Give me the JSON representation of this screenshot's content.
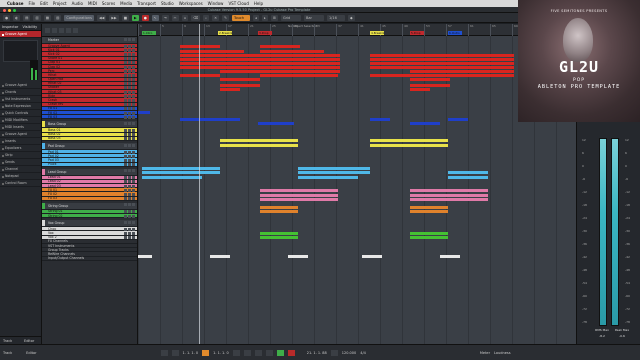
{
  "menubar": {
    "items": [
      "Cubase",
      "File",
      "Edit",
      "Project",
      "Audio",
      "MIDI",
      "Scores",
      "Media",
      "Transport",
      "Studio",
      "Workspaces",
      "Window",
      "VST Cloud",
      "Help"
    ],
    "clock": ""
  },
  "titlebar": {
    "text": "Cubase Version 9.5.50 Project - GL2u Cubase Pro Template"
  },
  "toolbar": {
    "configurations": "Configurations",
    "touch_mode": "Touch",
    "grid_mode": "Grid",
    "grid_type": "Bar",
    "quantize": "1/16"
  },
  "inspector": {
    "tabs": [
      "Inspector",
      "Visibility"
    ],
    "track_name": "Groove Agent",
    "rows": [
      "Groove Agent",
      "Chords",
      "Vst Instruments",
      "Note Expression",
      "Quick Controls",
      "MIDI Modifiers",
      "MIDI Inserts",
      "Groove Agent",
      "Inserts",
      "Equalizers",
      "Strip",
      "Sends",
      "Channel",
      "Notepad",
      "Control Room"
    ],
    "bottom_tabs": [
      "Track",
      "Editor"
    ]
  },
  "tracks": [
    {
      "name": "Marker",
      "color": "#3b3f45",
      "type": "folder"
    },
    {
      "name": "Groove Agent",
      "color": "#c0292e"
    },
    {
      "name": "Kick 01",
      "color": "#c0292e"
    },
    {
      "name": "Kick 02",
      "color": "#c0292e"
    },
    {
      "name": "Snare 01",
      "color": "#c0292e"
    },
    {
      "name": "Clap 01",
      "color": "#c0292e"
    },
    {
      "name": "Clap 02",
      "color": "#c0292e"
    },
    {
      "name": "Perc",
      "color": "#c0292e"
    },
    {
      "name": "Hihat",
      "color": "#c0292e"
    },
    {
      "name": "Open Hat",
      "color": "#c0292e"
    },
    {
      "name": "Hihat 02",
      "color": "#c0292e"
    },
    {
      "name": "Shaker",
      "color": "#c0292e"
    },
    {
      "name": "Hihat 03",
      "color": "#c0292e"
    },
    {
      "name": "Ride",
      "color": "#c0292e"
    },
    {
      "name": "Crash",
      "color": "#c0292e"
    },
    {
      "name": "Crash rev",
      "color": "#c0292e"
    },
    {
      "name": "Fill 01",
      "color": "#1f4fd1"
    },
    {
      "name": "Fill 02",
      "color": "#1f4fd1"
    },
    {
      "name": "Fill 03",
      "color": "#1f4fd1"
    },
    {
      "name": "Bass Group",
      "color": "#e8e04a",
      "type": "folder"
    },
    {
      "name": "Bass 01",
      "color": "#e8e04a"
    },
    {
      "name": "Bass 02",
      "color": "#e8e04a"
    },
    {
      "name": "Bass 03",
      "color": "#e8e04a"
    },
    {
      "name": "Pad Group",
      "color": "#4fb3e8",
      "type": "folder"
    },
    {
      "name": "Pad 01",
      "color": "#4fb3e8"
    },
    {
      "name": "Pad 02",
      "color": "#4fb3e8"
    },
    {
      "name": "Pad 03",
      "color": "#4fb3e8"
    },
    {
      "name": "Pluck",
      "color": "#4fb3e8"
    },
    {
      "name": "Lead Group",
      "color": "#e07aa8",
      "type": "folder"
    },
    {
      "name": "Lead 01",
      "color": "#e07aa8"
    },
    {
      "name": "Lead 02",
      "color": "#e07aa8"
    },
    {
      "name": "Lead 03",
      "color": "#e07aa8"
    },
    {
      "name": "FX 01",
      "color": "#e0822c"
    },
    {
      "name": "FX 02",
      "color": "#e0822c"
    },
    {
      "name": "FX 03",
      "color": "#e0822c"
    },
    {
      "name": "String Group",
      "color": "#3fae49",
      "type": "folder"
    },
    {
      "name": "String 01",
      "color": "#3fae49"
    },
    {
      "name": "String 02",
      "color": "#3fae49"
    },
    {
      "name": "Vox Group",
      "color": "#d9d9d9",
      "type": "folder"
    },
    {
      "name": "Chop",
      "color": "#d9d9d9"
    },
    {
      "name": "Vox",
      "color": "#d9d9d9"
    },
    {
      "name": "Vox 2",
      "color": "#d9d9d9"
    },
    {
      "name": "FX Channels",
      "color": "#2a2d32",
      "type": "sub"
    },
    {
      "name": "VST Instruments",
      "color": "#2a2d32",
      "type": "sub"
    },
    {
      "name": "Group Tracks",
      "color": "#2a2d32",
      "type": "sub"
    },
    {
      "name": "ReWire Channels",
      "color": "#2a2d32",
      "type": "sub"
    },
    {
      "name": "Input/Output Channels",
      "color": "#2a2d32",
      "type": "sub"
    }
  ],
  "ruler": {
    "bars": [
      "1",
      "5",
      "9",
      "13",
      "17",
      "21",
      "25",
      "29",
      "33",
      "37",
      "41",
      "45",
      "49",
      "53",
      "57",
      "61",
      "65",
      "69",
      "73",
      "77"
    ],
    "title": "No Object Selected",
    "markers": [
      {
        "label": "1-Intro",
        "color": "#3fae49"
      },
      {
        "label": "2-Breakdown",
        "color": "#e8e04a"
      },
      {
        "label": "3-Drop",
        "color": "#c0292e"
      },
      {
        "label": "4-Breakdown",
        "color": "#e8e04a"
      },
      {
        "label": "5-Drop",
        "color": "#c0292e"
      },
      {
        "label": "6-Outro",
        "color": "#1f4fd1"
      }
    ]
  },
  "cover": {
    "brand": "FIVE SEMITONES PRESENTS",
    "title": "GL2U",
    "genre": "POP",
    "subtitle": "ABLETON PRO TEMPLATE"
  },
  "mixer": {
    "header": "",
    "scale": [
      "12",
      "6",
      "0",
      "-6",
      "-12",
      "-18",
      "-24",
      "-30",
      "-36",
      "-42",
      "-48",
      "-54",
      "-60",
      "-72",
      "-78"
    ],
    "readouts": [
      "RMS Max",
      "Peak Max"
    ],
    "values": [
      "-8.2",
      "-0.6"
    ],
    "bottom_tabs": [
      "Meter",
      "Loudness"
    ]
  },
  "transport": {
    "position_left": "1. 1. 1. 0",
    "position_right": "1. 1. 1. 0",
    "position_main": "21. 1. 1. 88",
    "tempo": "120.000",
    "signature": "4/4",
    "tabs": [
      "Track",
      "Editor"
    ]
  }
}
